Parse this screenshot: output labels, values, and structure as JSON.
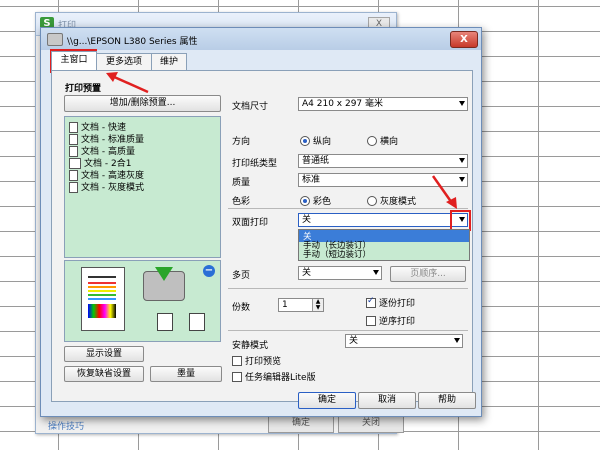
{
  "back_dialog": {
    "title": "打印",
    "close": "X",
    "help_link": "操作技巧",
    "ok": "确定",
    "cancel": "关闭"
  },
  "dialog": {
    "title": "\\\\g...\\EPSON L380 Series 属性",
    "close": "X",
    "tabs": [
      {
        "label": "主窗口"
      },
      {
        "label": "更多选项"
      },
      {
        "label": "维护"
      }
    ],
    "presets": {
      "heading": "打印预置",
      "add_remove_button": "增加/删除预置...",
      "items": [
        "文档 - 快速",
        "文档 - 标准质量",
        "文档 - 高质量",
        "文档 - 2合1",
        "文档 - 高速灰度",
        "文档 - 灰度模式"
      ]
    },
    "show_settings_button": "显示设置",
    "restore_defaults_button": "恢复缺省设置",
    "ink_levels_button": "墨量",
    "paper_size": {
      "label": "文档尺寸",
      "value": "A4 210 x 297 毫米"
    },
    "orientation": {
      "label": "方向",
      "options": [
        "纵向",
        "横向"
      ],
      "selected": "纵向"
    },
    "paper_type": {
      "label": "打印纸类型",
      "value": "普通纸"
    },
    "quality": {
      "label": "质量",
      "value": "标准"
    },
    "color": {
      "label": "色彩",
      "options": [
        "彩色",
        "灰度模式"
      ],
      "selected": "彩色"
    },
    "duplex": {
      "label": "双面打印",
      "value": "关",
      "dropdown_options": [
        "关",
        "手动（长边装订）",
        "手动（短边装订）"
      ]
    },
    "multipage": {
      "label": "多页",
      "value": "关",
      "order_button": "页顺序..."
    },
    "copies": {
      "label": "份数",
      "value": "1"
    },
    "collate": {
      "label": "逐份打印",
      "checked": true
    },
    "reverse": {
      "label": "逆序打印",
      "checked": false
    },
    "quiet_mode": {
      "label": "安静模式",
      "value": "关"
    },
    "print_preview": {
      "label": "打印预览",
      "checked": false
    },
    "job_arranger": {
      "label": "任务编辑器Lite版",
      "checked": false
    },
    "ok_button": "确定",
    "cancel_button": "取消",
    "help_button": "帮助"
  },
  "colors": {
    "preset_bg": "#c7ead1",
    "annotation_red": "#e02020",
    "title_bar": "#b9cde6"
  }
}
